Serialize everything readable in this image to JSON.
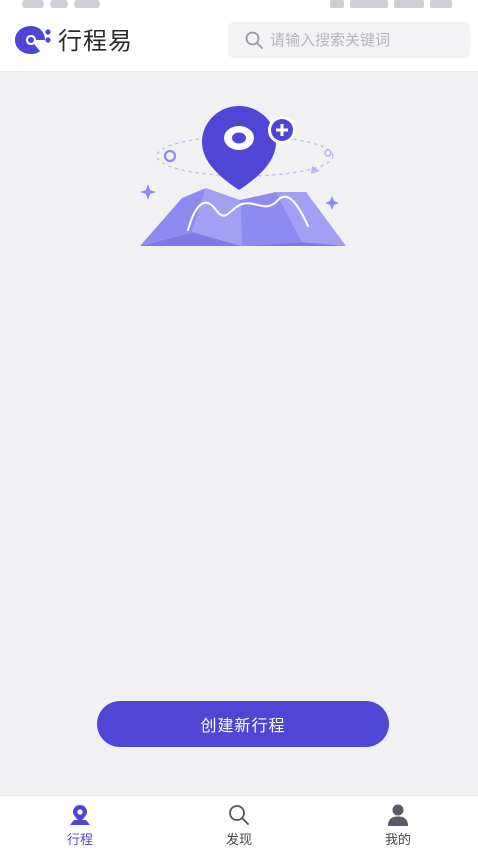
{
  "header": {
    "app_title": "行程易",
    "search_placeholder": "请输入搜索关键词"
  },
  "main": {
    "create_button_label": "创建新行程"
  },
  "tabbar": {
    "items": [
      {
        "label": "行程",
        "icon": "map-pin-icon",
        "active": true
      },
      {
        "label": "发现",
        "icon": "search-icon",
        "active": false
      },
      {
        "label": "我的",
        "icon": "user-icon",
        "active": false
      }
    ]
  },
  "colors": {
    "accent": "#4f46d6",
    "background": "#f1f1f3",
    "illustration_light": "#8f8af0"
  }
}
